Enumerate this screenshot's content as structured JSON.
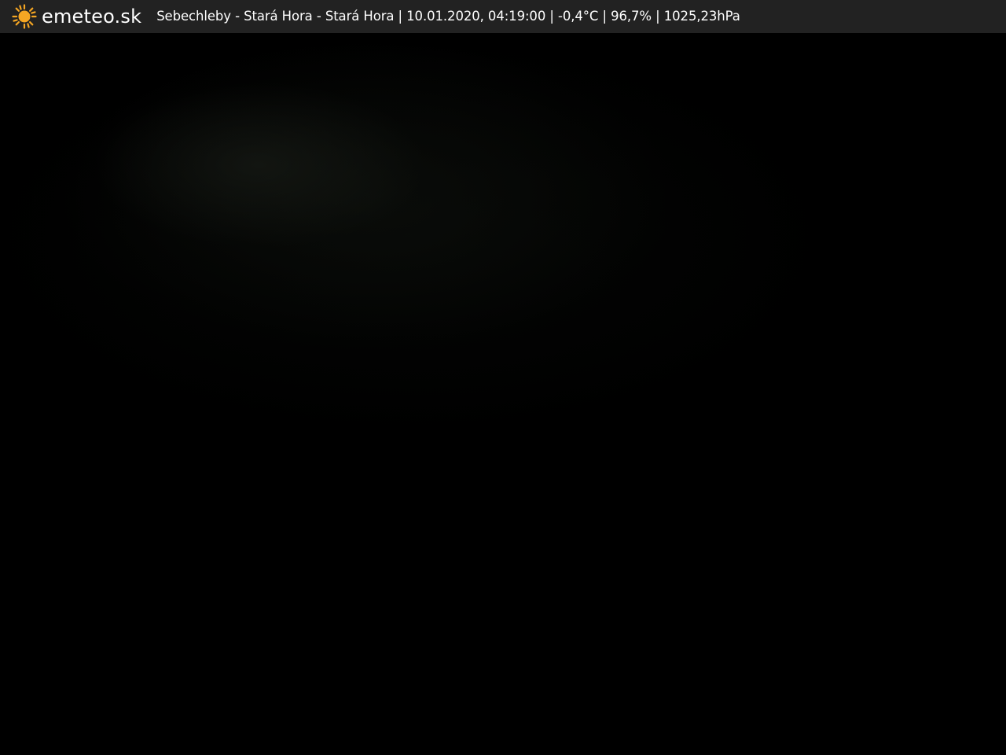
{
  "overlay": {
    "logo_icon": "sun-icon",
    "brand_text": "emeteo.sk",
    "caption": "Sebechleby - Stará Hora - Stará Hora | 10.01.2020, 04:19:00 | -0,4°C | 96,7% | 1025,23hPa",
    "colors": {
      "bar_background": "#222222",
      "text": "#ffffff",
      "sun": "#f5a623"
    }
  }
}
